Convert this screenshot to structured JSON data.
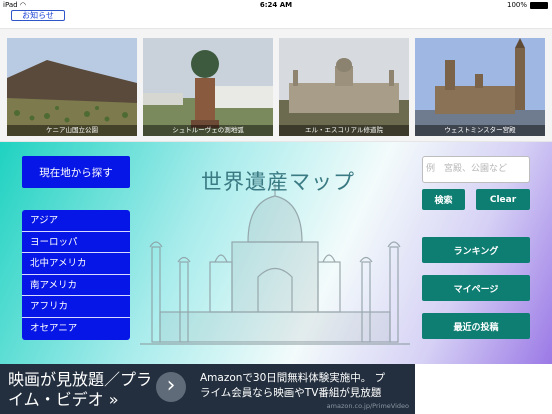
{
  "status_bar": {
    "device": "iPad",
    "time": "6:24 AM",
    "battery": "100%"
  },
  "notice_button": "お知らせ",
  "gallery": [
    {
      "caption": "ケニア山国立公園",
      "image": "mountain-photo"
    },
    {
      "caption": "シュトルーヴェの測地弧",
      "image": "monument-photo"
    },
    {
      "caption": "エル・エスコリアル修道院",
      "image": "monastery-photo"
    },
    {
      "caption": "ウェストミンスター宮殿",
      "image": "palace-photo"
    }
  ],
  "main": {
    "locate_button": "現在地から探す",
    "title": "世界遺産マップ",
    "search_placeholder": "例　宮殿、公園など",
    "search_button": "検索",
    "clear_button": "Clear",
    "regions": [
      "アジア",
      "ヨーロッパ",
      "北中アメリカ",
      "南アメリカ",
      "アフリカ",
      "オセアニア"
    ],
    "menu": {
      "ranking": "ランキング",
      "mypage": "マイページ",
      "recent": "最近の投稿"
    }
  },
  "ad": {
    "lead": "映画が見放題／プライム・ビデオ »",
    "line1": "Amazonで30日間無料体験実施中。 プ",
    "line2": "ライム会員なら映画やTV番組が見放題",
    "url": "amazon.co.jp/PrimeVideo"
  },
  "colors": {
    "blue": "#0616e6",
    "teal": "#0e7e73",
    "ad_bg": "#232f3e"
  }
}
